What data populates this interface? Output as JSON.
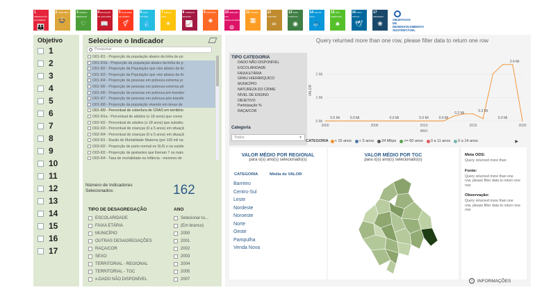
{
  "sdg_icons": [
    {
      "num": "1",
      "label": "ERRADICAÇÃO DA POBREZA",
      "glyph": "👪",
      "color": "#e5243b"
    },
    {
      "num": "2",
      "label": "FOME ZERO",
      "glyph": "🍲",
      "color": "#dda63a"
    },
    {
      "num": "3",
      "label": "SAÚDE E BEM-ESTAR",
      "glyph": "♡",
      "color": "#4c9f38"
    },
    {
      "num": "4",
      "label": "EDUCAÇÃO DE QUALIDADE",
      "glyph": "📖",
      "color": "#c5192d"
    },
    {
      "num": "5",
      "label": "IGUALDADE DE GÊNERO",
      "glyph": "⚥",
      "color": "#ff3a21"
    },
    {
      "num": "6",
      "label": "ÁGUA POTÁVEL",
      "glyph": "💧",
      "color": "#26bde2"
    },
    {
      "num": "7",
      "label": "ENERGIA LIMPA",
      "glyph": "☀",
      "color": "#fcc30b"
    },
    {
      "num": "8",
      "label": "TRABALHO DECENTE",
      "glyph": "📈",
      "color": "#a21942"
    },
    {
      "num": "9",
      "label": "INDÚSTRIA",
      "glyph": "◈",
      "color": "#fd6925"
    },
    {
      "num": "10",
      "label": "REDUÇÃO DAS DESIGUALDADES",
      "glyph": "⊜",
      "color": "#dd1367"
    },
    {
      "num": "11",
      "label": "CIDADES",
      "glyph": "▦",
      "color": "#fd9d24"
    },
    {
      "num": "12",
      "label": "CONSUMO",
      "glyph": "∞",
      "color": "#bf8b2e"
    },
    {
      "num": "13",
      "label": "AÇÃO CLIMÁTICA",
      "glyph": "◉",
      "color": "#3f7e44"
    },
    {
      "num": "14",
      "label": "VIDA NA ÁGUA",
      "glyph": "🐟",
      "color": "#0a97d9"
    },
    {
      "num": "15",
      "label": "VIDA TERRESTRE",
      "glyph": "♣",
      "color": "#56c02b"
    },
    {
      "num": "16",
      "label": "PAZ E JUSTIÇA",
      "glyph": "🕊",
      "color": "#00689d"
    },
    {
      "num": "17",
      "label": "PARCERIAS",
      "glyph": "❀",
      "color": "#19486a"
    }
  ],
  "sdg_logo": {
    "line1": "OBJETIVOS",
    "line2": "DE DESENVOLVIMENTO",
    "line3": "SUSTENTÁVEL"
  },
  "objective_panel": {
    "title": "Objetivo",
    "items": [
      "1",
      "2",
      "3",
      "4",
      "5",
      "6",
      "7",
      "8",
      "9",
      "10",
      "11",
      "12",
      "13",
      "14",
      "15",
      "16",
      "17"
    ]
  },
  "indicator_panel": {
    "title": "Selecione o Indicador",
    "search_placeholder": "Pesquisar",
    "items": [
      "O01-I01 - Proporção da população abaixo da linha de po",
      "O01-I01b - Proporção da população abaixo da linha de p",
      "O01-I02 - Proporção da População que vive abaixo da lin",
      "O01-I03 - Proporção da População que vive abaixo da lin",
      "O01-I04 - Proporção de pessoas em pobreza extrema pr",
      "O01-I05 - Proporção de pessoas em pobreza extrema pó",
      "O01-I06 - Proporção de pessoas em pobreza pré-transfer",
      "O01-I07 - Proporção de pessoas em pobreza pós-transfe",
      "O01-I08 - Proporção da população vivendo em áreas de",
      "O01-I09 - Percentual de cobertura de CRAS em território",
      "O02-I01a - Percentual de adultos (≥ 18 anos) que conso",
      "O02-I02 - Percentual de adultos (≥ 18 anos) que substitu",
      "O02-I03 - Percentual de crianças (0 a 5 anos) em situaçã",
      "O02-I04 - Percentual de crianças (0 a 5 anos) em situaçã",
      "O03-I01 - Razão de Mortalidade Materna (por 100 mil na",
      "O03-I02 - Proporção de parto normal no SUS e na saúde",
      "O03-I02 - Proporção de gestantes que fizeram 7 ou mais",
      "O03-I04 - Taxa de mortalidade na Infância - menores de"
    ],
    "count_label": "Número de Indicadores Selecionados:",
    "count_value": "162"
  },
  "disaggregation_panel": {
    "title": "TIPO DE DESAGREGAÇÃO",
    "items": [
      "ESCOLARIDADE",
      "FAIXA ETÁRIA",
      "MUNICÍPIO",
      "OUTRAS DESAGREGAÇÕES",
      "RAÇA/COR",
      "SEXO",
      "TERRITORIAL - REGIONAL",
      "TERRITORIAL - TGC",
      "x-DADO NÃO DISPONÍVEL"
    ]
  },
  "year_panel": {
    "title": "ANO",
    "items": [
      "Selecionar tu...",
      "(Em branco)",
      "2000",
      "2001",
      "2002",
      "2003",
      "2004",
      "2005",
      "2007"
    ]
  },
  "right_panel": {
    "message": "Query returned more than one row, please filter data to return one row",
    "tipo_categoria": {
      "title": "TIPO CATEGORIA",
      "items": [
        "DADO NÃO DISPONÍVEL",
        "ESCOLARIDADE",
        "FAIXA ETÁRIA",
        "GRAU HIERÁRQUICO",
        "MUNICÍPIO",
        "NATUREZA DO CRIME",
        "NÍVEL DE ENSINO",
        "OBJETIVO",
        "Participação %",
        "RAÇA/COR"
      ],
      "categoria_label": "Categoria",
      "categoria_value": "Todos"
    },
    "chart_legend": {
      "title": "CATEGORIA",
      "items": [
        {
          "label": "< 15 anos",
          "color": "#f28e2b"
        },
        {
          "label": "< 5 anos",
          "color": "#4e79a7"
        },
        {
          "label": "34 Mbps",
          "color": "#555555"
        },
        {
          "label": ">= 60 anos",
          "color": "#59a14f"
        },
        {
          "label": "0 a 11 anos",
          "color": "#e15759"
        },
        {
          "label": "0 a 14 anos",
          "color": "#76b7b2"
        }
      ],
      "nav": "▶"
    },
    "regional": {
      "title": "VALOR MÉDIO POR REGIONAL",
      "subtitle": "para o(s) ano(s) selecionado(s)",
      "col1": "CATEGORIA",
      "col2": "Média de VALOR",
      "items": [
        "Barreiro",
        "Centro-Sul",
        "Leste",
        "Nordeste",
        "Noroeste",
        "Norte",
        "Oeste",
        "Pampulha",
        "Venda Nova"
      ]
    },
    "tgc": {
      "title": "VALOR MÉDIO POR TGC",
      "subtitle": "para o(s) ano(s) selecionado(s)"
    },
    "meta": {
      "meta_label": "Meta ODS:",
      "meta_text": "Query returned more than",
      "fonte_label": "Fonte:",
      "fonte_text": "Query returned more than one row, please filter data to return one row",
      "obs_label": "Observação:",
      "obs_text": "Query returned more than one row, please filter data to return one row"
    },
    "info_label": "INFORMAÇÕES"
  },
  "chart_data": {
    "type": "line",
    "title": "",
    "xlabel": "ANO",
    "ylabel": "VALOR",
    "x_ticks": [
      "2000",
      "2005",
      "2010",
      "2015",
      "2020"
    ],
    "y_ticks": [
      "0 Mi",
      "1 Mi",
      "2 Mi"
    ],
    "xlim": [
      2000,
      2020
    ],
    "ylim": [
      0,
      2.6
    ],
    "series": [
      {
        "name": "",
        "color": "#f28e2b",
        "x": [
          2000,
          2001,
          2002,
          2003,
          2004,
          2005,
          2006,
          2007,
          2008,
          2009,
          2010,
          2011,
          2012,
          2013,
          2014,
          2015,
          2016,
          2017,
          2018,
          2019,
          2020
        ],
        "y": [
          0,
          0,
          0,
          0,
          0,
          0,
          0,
          0,
          0,
          0,
          0,
          0,
          0,
          0.2,
          0.3,
          0.3,
          0.1,
          2.0,
          2.4,
          2.4,
          0
        ],
        "data_labels": [
          {
            "x": 2001,
            "y": 0,
            "text": "0.0 Mi"
          },
          {
            "x": 2003,
            "y": 0,
            "text": "0.0 Mi"
          },
          {
            "x": 2007,
            "y": 0,
            "text": "0.0 Mi"
          },
          {
            "x": 2010,
            "y": 0,
            "text": "0.0 Mi"
          },
          {
            "x": 2012,
            "y": 0,
            "text": "0.0 Mi"
          },
          {
            "x": 2013.6,
            "y": 0.2,
            "text": "0.2 Mi"
          },
          {
            "x": 2016,
            "y": 0.3,
            "text": "0.3 Mi"
          },
          {
            "x": 2018,
            "y": 0,
            "text": "0.0 Mi"
          },
          {
            "x": 2019.2,
            "y": 2.4,
            "text": "2.4 Mi"
          }
        ]
      }
    ],
    "grid": true,
    "legend": "bottom"
  }
}
